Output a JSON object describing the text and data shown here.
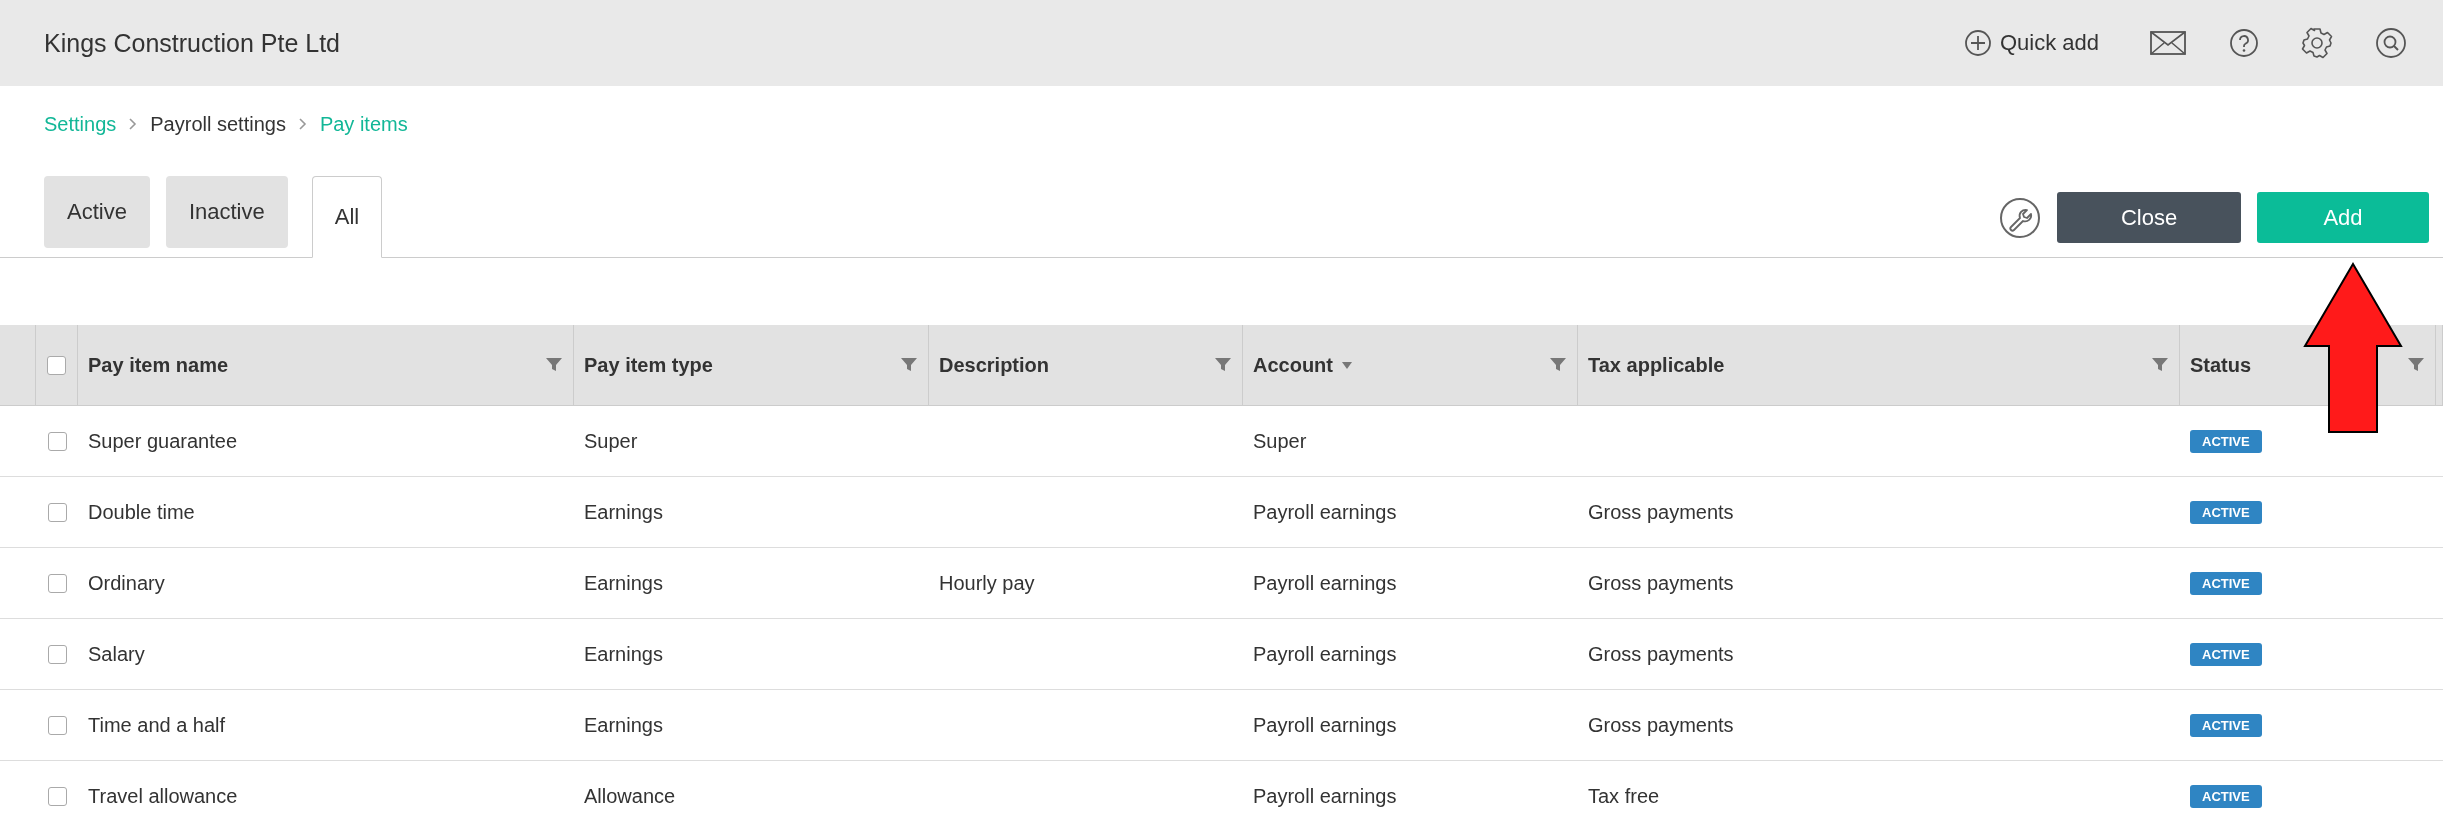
{
  "header": {
    "title": "Kings Construction Pte Ltd",
    "quick_add": "Quick add"
  },
  "breadcrumb": [
    {
      "label": "Settings",
      "link": true
    },
    {
      "label": "Payroll settings",
      "link": false
    },
    {
      "label": "Pay items",
      "link": true
    }
  ],
  "tabs": [
    {
      "label": "Active",
      "selected": false
    },
    {
      "label": "Inactive",
      "selected": false
    },
    {
      "label": "All",
      "selected": true
    }
  ],
  "buttons": {
    "close": "Close",
    "add": "Add"
  },
  "table": {
    "select_all_checked": false,
    "columns": [
      {
        "label": "Pay item name",
        "sorted": false
      },
      {
        "label": "Pay item type",
        "sorted": false
      },
      {
        "label": "Description",
        "sorted": false
      },
      {
        "label": "Account",
        "sorted": true
      },
      {
        "label": "Tax applicable",
        "sorted": false
      },
      {
        "label": "Status",
        "sorted": false
      }
    ],
    "rows": [
      {
        "checked": false,
        "cells": [
          "Super guarantee",
          "Super",
          "",
          "Super",
          ""
        ],
        "status": "ACTIVE"
      },
      {
        "checked": false,
        "cells": [
          "Double time",
          "Earnings",
          "",
          "Payroll earnings",
          "Gross payments"
        ],
        "status": "ACTIVE"
      },
      {
        "checked": false,
        "cells": [
          "Ordinary",
          "Earnings",
          "Hourly pay",
          "Payroll earnings",
          "Gross payments"
        ],
        "status": "ACTIVE"
      },
      {
        "checked": false,
        "cells": [
          "Salary",
          "Earnings",
          "",
          "Payroll earnings",
          "Gross payments"
        ],
        "status": "ACTIVE"
      },
      {
        "checked": false,
        "cells": [
          "Time and a half",
          "Earnings",
          "",
          "Payroll earnings",
          "Gross payments"
        ],
        "status": "ACTIVE"
      },
      {
        "checked": false,
        "cells": [
          "Travel allowance",
          "Allowance",
          "",
          "Payroll earnings",
          "Tax free"
        ],
        "status": "ACTIVE"
      }
    ]
  }
}
